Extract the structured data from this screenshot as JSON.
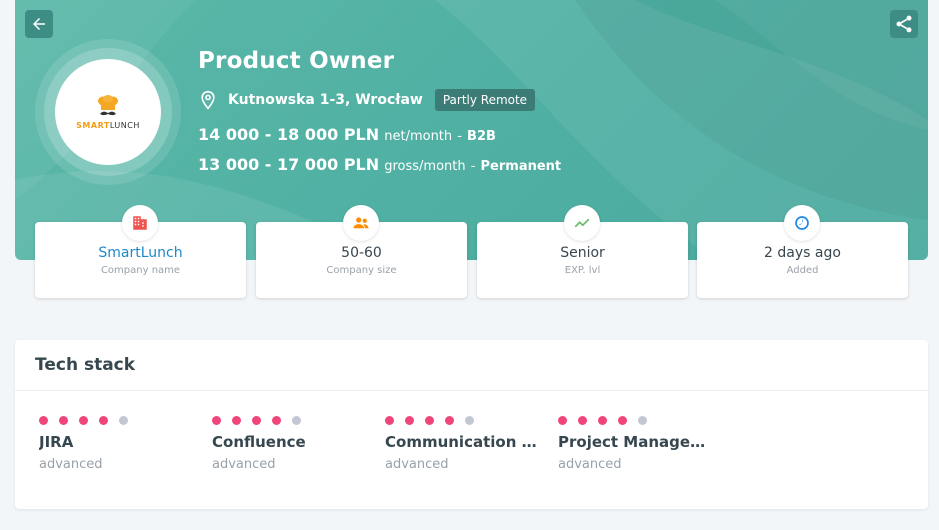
{
  "header": {
    "title": "Product Owner",
    "address": "Kutnowska 1-3, Wrocław",
    "remote_badge": "Partly Remote",
    "salaries": [
      {
        "amount": "14 000 - 18 000 PLN",
        "period": "net/month",
        "sep": "-",
        "contract": "B2B"
      },
      {
        "amount": "13 000 - 17 000 PLN",
        "period": "gross/month",
        "sep": "-",
        "contract": "Permanent"
      }
    ],
    "logo": {
      "brand_part1": "SMART",
      "brand_part2": "LUNCH",
      "icon": "chef-hat-mustache-icon"
    },
    "back_icon": "arrow-left-icon",
    "share_icon": "share-icon"
  },
  "info_cards": [
    {
      "value": "SmartLunch",
      "label": "Company name",
      "icon": "building-icon",
      "icon_color": "#ef5350"
    },
    {
      "value": "50-60",
      "label": "Company size",
      "icon": "people-icon",
      "icon_color": "#fb8c00"
    },
    {
      "value": "Senior",
      "label": "EXP. lvl",
      "icon": "trend-up-icon",
      "icon_color": "#66bb6a"
    },
    {
      "value": "2 days ago",
      "label": "Added",
      "icon": "clock-icon",
      "icon_color": "#1e88e5"
    }
  ],
  "tech_stack": {
    "title": "Tech stack",
    "skills": [
      {
        "name": "JIRA",
        "level": "advanced",
        "rating": 4,
        "max": 5
      },
      {
        "name": "Confluence",
        "level": "advanced",
        "rating": 4,
        "max": 5
      },
      {
        "name": "Communication S...",
        "level": "advanced",
        "rating": 4,
        "max": 5
      },
      {
        "name": "Project Managem...",
        "level": "advanced",
        "rating": 4,
        "max": 5
      }
    ]
  },
  "colors": {
    "banner": "#4fb0a3",
    "dot_active": "#f0457a",
    "dot_inactive": "#c3c7d4",
    "link": "#1e88c8"
  }
}
